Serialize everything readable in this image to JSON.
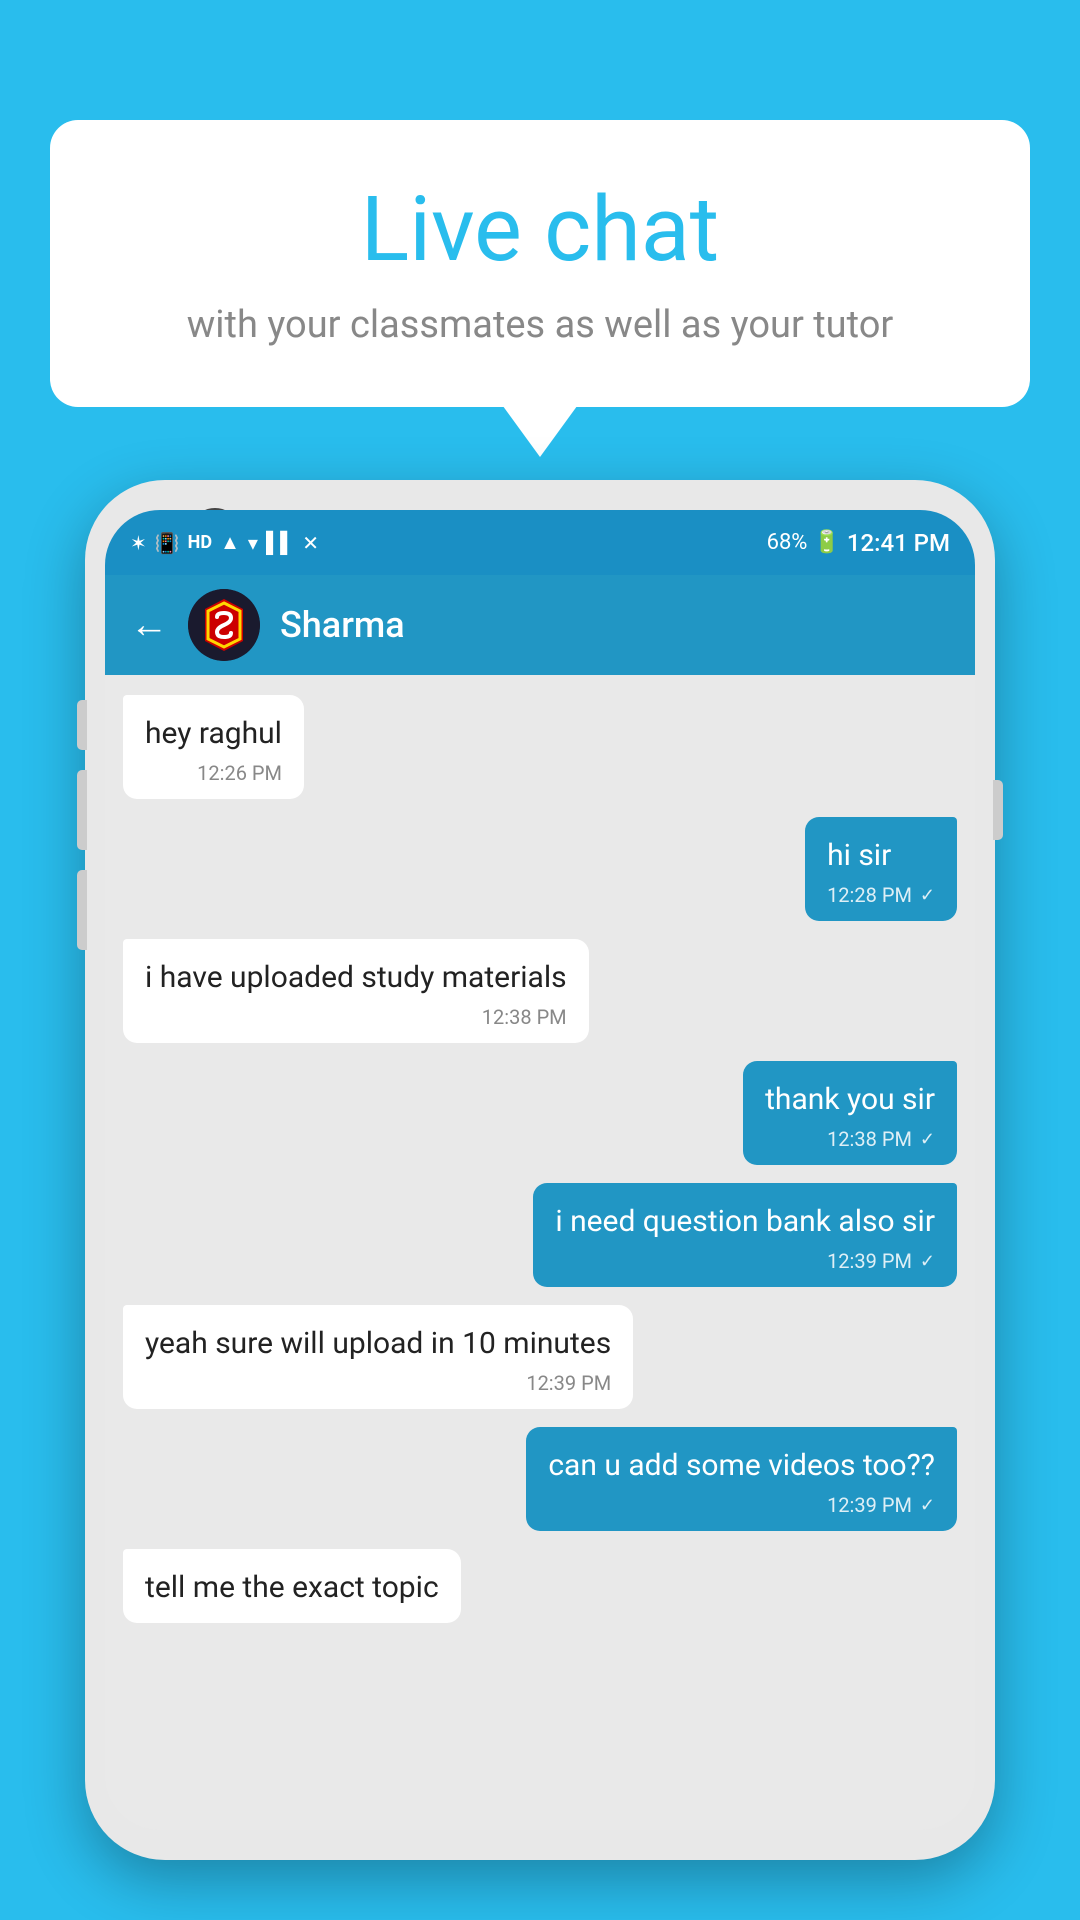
{
  "background_color": "#29BDED",
  "speech_bubble": {
    "title": "Live chat",
    "subtitle": "with your classmates as well as your tutor"
  },
  "phone": {
    "status_bar": {
      "time": "12:41 PM",
      "battery": "68%"
    },
    "chat_header": {
      "contact_name": "Sharma",
      "back_label": "←"
    },
    "messages": [
      {
        "id": 1,
        "type": "received",
        "text": "hey raghul",
        "time": "12:26 PM",
        "check": false
      },
      {
        "id": 2,
        "type": "sent",
        "text": "hi sir",
        "time": "12:28 PM",
        "check": true
      },
      {
        "id": 3,
        "type": "received",
        "text": "i have uploaded study materials",
        "time": "12:38 PM",
        "check": false
      },
      {
        "id": 4,
        "type": "sent",
        "text": "thank you sir",
        "time": "12:38 PM",
        "check": true
      },
      {
        "id": 5,
        "type": "sent",
        "text": "i need question bank also sir",
        "time": "12:39 PM",
        "check": true
      },
      {
        "id": 6,
        "type": "received",
        "text": "yeah sure will upload in 10 minutes",
        "time": "12:39 PM",
        "check": false
      },
      {
        "id": 7,
        "type": "sent",
        "text": "can u add some videos too??",
        "time": "12:39 PM",
        "check": true
      },
      {
        "id": 8,
        "type": "received",
        "text": "tell me the exact topic",
        "time": "",
        "check": false,
        "partial": true
      }
    ]
  }
}
